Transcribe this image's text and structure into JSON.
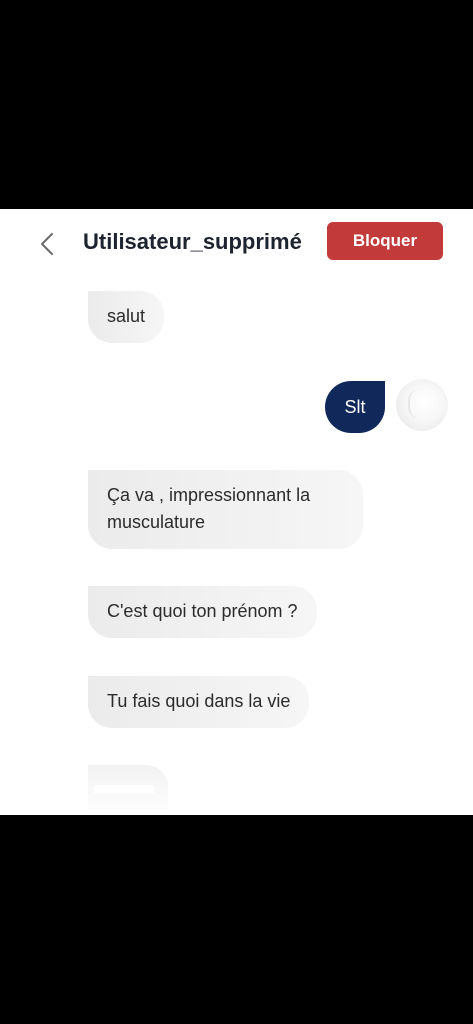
{
  "header": {
    "title": "Utilisateur_supprimé",
    "block_label": "Bloquer"
  },
  "messages": [
    {
      "direction": "incoming",
      "text": "salut"
    },
    {
      "direction": "outgoing",
      "text": "Slt"
    },
    {
      "direction": "incoming",
      "text": "Ça va , impressionnant la musculature"
    },
    {
      "direction": "incoming",
      "text": "C'est quoi ton prénom ?"
    },
    {
      "direction": "incoming",
      "text": "Tu fais quoi dans la vie"
    }
  ],
  "colors": {
    "block_button": "#c23a3a",
    "outgoing_bubble": "#10285a",
    "incoming_bubble": "#efefef",
    "title_text": "#1e2330"
  },
  "icons": {
    "back": "chevron-left-icon"
  }
}
